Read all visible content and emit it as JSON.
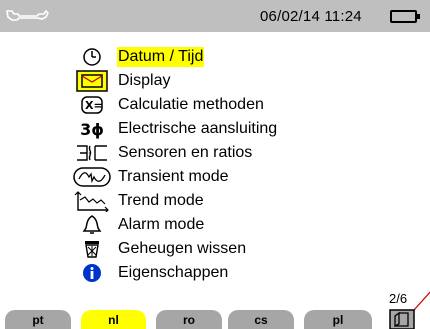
{
  "status_bar": {
    "datetime": "06/02/14  11:24",
    "tool_icon": "wrench-icon",
    "battery_icon": "battery-icon"
  },
  "menu": {
    "items": [
      {
        "label": "Datum / Tijd",
        "icon": "clock-icon",
        "selected": true
      },
      {
        "label": "Display",
        "icon": "display-icon",
        "selected": false
      },
      {
        "label": "Calculatie methoden",
        "icon": "calculation-icon",
        "selected": false
      },
      {
        "label": "Electrische aansluiting",
        "icon": "three-phase-icon",
        "selected": false
      },
      {
        "label": "Sensoren en ratios",
        "icon": "sensor-icon",
        "selected": false
      },
      {
        "label": "Transient mode",
        "icon": "transient-icon",
        "selected": false
      },
      {
        "label": "Trend mode",
        "icon": "trend-icon",
        "selected": false
      },
      {
        "label": "Alarm mode",
        "icon": "bell-icon",
        "selected": false
      },
      {
        "label": "Geheugen wissen",
        "icon": "trash-icon",
        "selected": false
      },
      {
        "label": "Eigenschappen",
        "icon": "info-icon",
        "selected": false
      }
    ],
    "three_phase_glyph": "3ϕ"
  },
  "footer": {
    "tabs": [
      {
        "label": "pt",
        "active": false
      },
      {
        "label": "nl",
        "active": true
      },
      {
        "label": "ro",
        "active": false
      },
      {
        "label": "cs",
        "active": false
      },
      {
        "label": "pl",
        "active": false
      }
    ],
    "page_indicator": "2/6",
    "next_icon": "next-page-icon"
  },
  "colors": {
    "highlight": "#ffff00",
    "bar_gray": "#bfbfbf",
    "tab_gray": "#a6a6a6",
    "info_blue": "#0033cc",
    "accent_red": "#cc0000"
  }
}
